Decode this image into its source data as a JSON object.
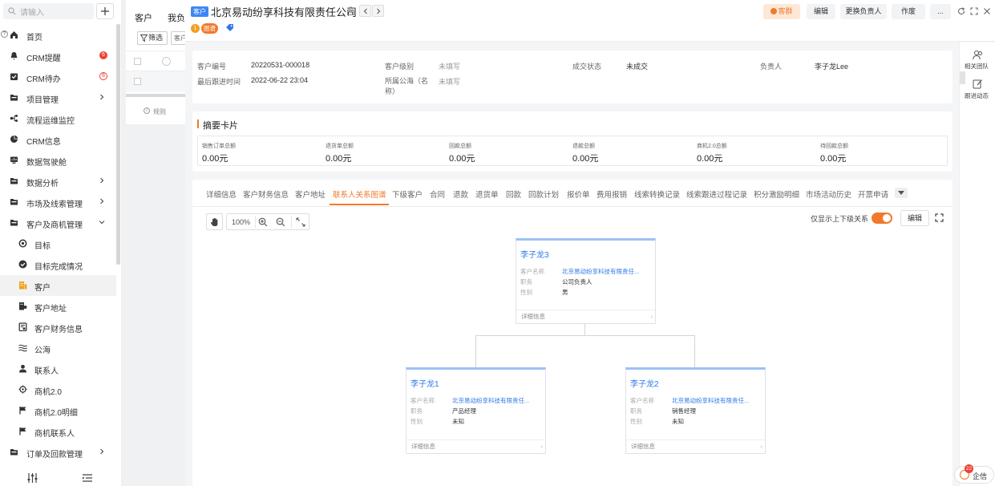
{
  "sidebar": {
    "search_placeholder": "请输入",
    "items": [
      {
        "label": "首页",
        "icon": "home-icon"
      },
      {
        "label": "CRM提醒",
        "icon": "bell-icon",
        "badge": "6"
      },
      {
        "label": "CRM待办",
        "icon": "todo-icon",
        "badge": "8"
      },
      {
        "label": "项目管理",
        "icon": "folder-icon"
      },
      {
        "label": "流程运维监控",
        "icon": "flow-icon"
      },
      {
        "label": "CRM信息",
        "icon": "pie-icon"
      },
      {
        "label": "数据驾驶舱",
        "icon": "dashboard-icon"
      },
      {
        "label": "数据分析",
        "icon": "folder-icon"
      },
      {
        "label": "市场及线索管理",
        "icon": "folder-icon"
      },
      {
        "label": "客户及商机管理",
        "icon": "folder-icon"
      },
      {
        "label": "目标",
        "icon": "target-icon"
      },
      {
        "label": "目标完成情况",
        "icon": "check-badge-icon"
      },
      {
        "label": "客户",
        "icon": "building-icon"
      },
      {
        "label": "客户地址",
        "icon": "address-icon"
      },
      {
        "label": "客户财务信息",
        "icon": "finance-icon"
      },
      {
        "label": "公海",
        "icon": "waves-icon"
      },
      {
        "label": "联系人",
        "icon": "person-icon"
      },
      {
        "label": "商机2.0",
        "icon": "crosshair-icon"
      },
      {
        "label": "商机2.0明细",
        "icon": "flag-icon"
      },
      {
        "label": "商机联系人",
        "icon": "flag-icon"
      },
      {
        "label": "订单及回款管理",
        "icon": "folder-icon"
      }
    ]
  },
  "listpanel": {
    "tabs": [
      "客户",
      "我负"
    ],
    "filter_label": "筛选",
    "small_label": "客户",
    "rule_label": "规则"
  },
  "header": {
    "tag": "客户",
    "title": "北京易动纷享科技有限责任公司",
    "tags": [
      "1",
      "图谱"
    ],
    "buttons": {
      "group": "客群",
      "edit": "编辑",
      "change_owner": "更换负责人",
      "void": "作废",
      "more": "..."
    }
  },
  "info": {
    "fields": [
      {
        "label": "客户编号",
        "value": "20220531-000018"
      },
      {
        "label": "客户级别",
        "value": "未填写"
      },
      {
        "label": "成交状态",
        "value": "未成交"
      },
      {
        "label": "负责人",
        "value": "李子龙Lee"
      },
      {
        "label": "最后跟进时间",
        "value": "2022-06-22 23:04"
      },
      {
        "label": "所属公海（名称）",
        "value": "未填写"
      }
    ]
  },
  "summary": {
    "title": "摘要卡片",
    "stats": [
      {
        "label": "销售订单总额",
        "value": "0.00元"
      },
      {
        "label": "退货单总额",
        "value": "0.00元"
      },
      {
        "label": "回款总额",
        "value": "0.00元"
      },
      {
        "label": "退款总额",
        "value": "0.00元"
      },
      {
        "label": "商机2.0总额",
        "value": "0.00元"
      },
      {
        "label": "待回款总额",
        "value": "0.00元"
      }
    ]
  },
  "tabs": [
    "详细信息",
    "客户财务信息",
    "客户地址",
    "联系人关系图谱",
    "下级客户",
    "合同",
    "退款",
    "退货单",
    "回款",
    "回款计划",
    "报价单",
    "费用报销",
    "线索转换记录",
    "线索跟进过程记录",
    "积分激励明细",
    "市场活动历史",
    "开票申请"
  ],
  "graph": {
    "zoom": "100%",
    "toggle_label": "仅显示上下级关系",
    "toggle_on": true,
    "edit_label": "编辑",
    "nodes": [
      {
        "name": "李子龙3",
        "company": "北京易动纷享科技有限责任...",
        "position": "公司负责人",
        "gender": "男"
      },
      {
        "name": "李子龙1",
        "company": "北京易动纷享科技有限责任...",
        "position": "产品经理",
        "gender": "未知"
      },
      {
        "name": "李子龙2",
        "company": "北京易动纷享科技有限责任...",
        "position": "销售经理",
        "gender": "未知"
      }
    ],
    "keys": {
      "company": "客户名称",
      "position": "职务",
      "gender": "性别",
      "detail": "详细信息"
    }
  },
  "right_rail": {
    "team": "相关团队",
    "follow": "跟进动态"
  },
  "chat": {
    "label": "企信",
    "badge": "22"
  },
  "colors": {
    "accent": "#f07a2a",
    "link": "#2f78e8",
    "badge": "#f04134"
  }
}
